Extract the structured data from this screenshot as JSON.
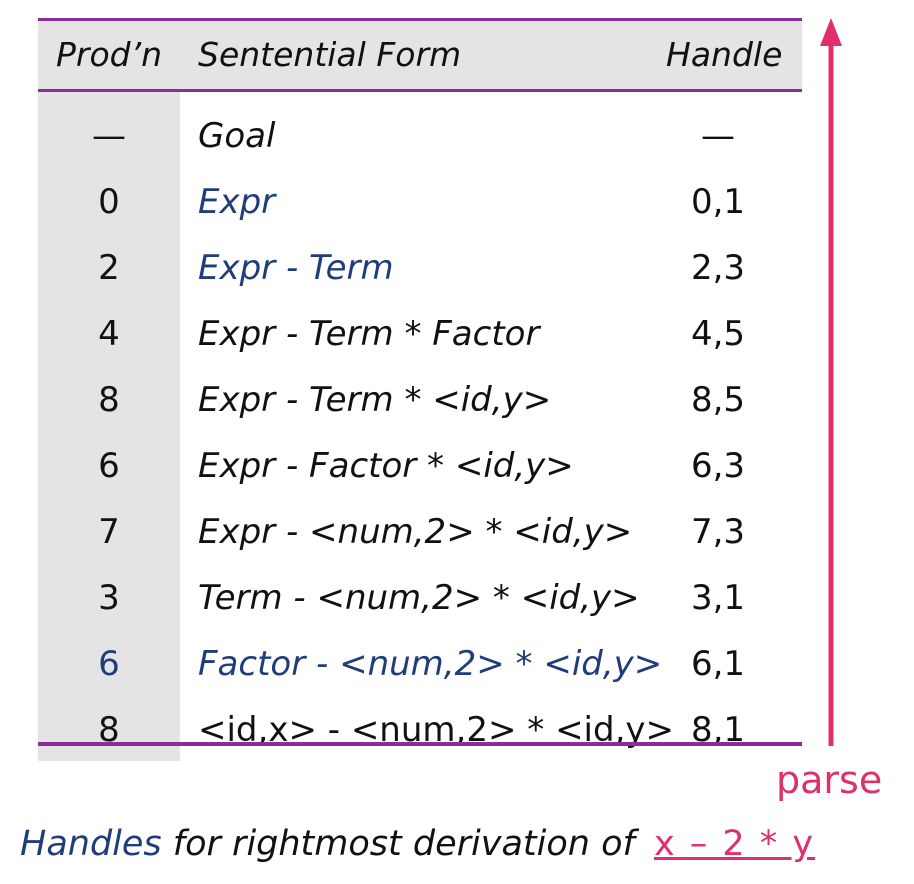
{
  "table": {
    "headers": {
      "prod": "Prod’n",
      "form": "Sentential Form",
      "handle": "Handle"
    },
    "rows": [
      {
        "prod": "—",
        "form": "Goal",
        "handle": "—"
      },
      {
        "prod": "0",
        "form": "Expr",
        "handle": "0,1"
      },
      {
        "prod": "2",
        "form": "Expr - Term",
        "handle": "2,3"
      },
      {
        "prod": "4",
        "form": "Expr - Term * Factor",
        "handle": "4,5"
      },
      {
        "prod": "8",
        "form": "Expr - Term * <id,y>",
        "handle": "8,5"
      },
      {
        "prod": "6",
        "form": "Expr - Factor * <id,y>",
        "handle": "6,3"
      },
      {
        "prod": "7",
        "form": "Expr - <num,2> * <id,y>",
        "handle": "7,3"
      },
      {
        "prod": "3",
        "form": "Term - <num,2> * <id,y>",
        "handle": "3,1"
      },
      {
        "prod": "6",
        "form": "Factor - <num,2> * <id,y>",
        "handle": "6,1"
      },
      {
        "prod": "8",
        "form": "<id,x> - <num,2> * <id,y>",
        "handle": "8,1"
      }
    ]
  },
  "parse_label": "parse",
  "caption": {
    "handles_word": "Handles",
    "rest": " for rightmost derivation of ",
    "expression": "x – 2 * y"
  },
  "colors": {
    "accent_line": "#8a2f9a",
    "arrow": "#e0306a",
    "term_blue": "#1f3d7a",
    "highlight_pink": "#e0306a"
  }
}
